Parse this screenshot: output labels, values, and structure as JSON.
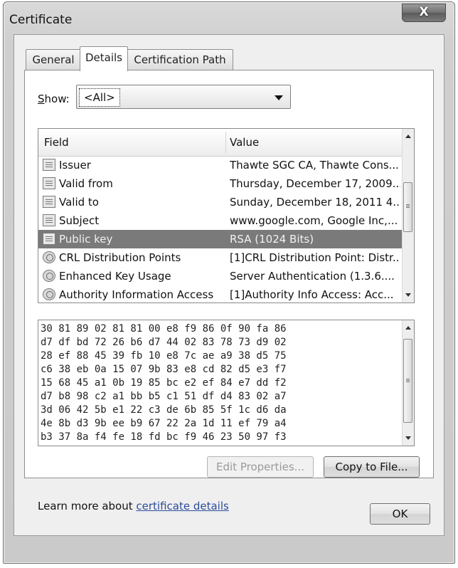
{
  "window": {
    "title": "Certificate",
    "close_label": "X"
  },
  "tabs": [
    {
      "label": "General"
    },
    {
      "label": "Details"
    },
    {
      "label": "Certification Path"
    }
  ],
  "show": {
    "label_prefix": "S",
    "label_rest": "how:",
    "selected": "<All>"
  },
  "fields_table": {
    "columns": [
      "Field",
      "Value"
    ],
    "rows": [
      {
        "field": "Issuer",
        "value": "Thawte SGC CA, Thawte Cons...",
        "icon": "document-icon"
      },
      {
        "field": "Valid from",
        "value": "Thursday, December 17, 2009...",
        "icon": "document-icon"
      },
      {
        "field": "Valid to",
        "value": "Sunday, December 18, 2011 4...",
        "icon": "document-icon"
      },
      {
        "field": "Subject",
        "value": "www.google.com, Google Inc,...",
        "icon": "document-icon"
      },
      {
        "field": "Public key",
        "value": "RSA (1024 Bits)",
        "icon": "document-icon",
        "selected": true
      },
      {
        "field": "CRL Distribution Points",
        "value": "[1]CRL Distribution Point: Distr...",
        "icon": "extension-icon"
      },
      {
        "field": "Enhanced Key Usage",
        "value": "Server Authentication (1.3.6....",
        "icon": "extension-icon"
      },
      {
        "field": "Authority Information Access",
        "value": "[1]Authority Info Access: Acc...",
        "icon": "extension-icon"
      }
    ]
  },
  "hex_value": "30 81 89 02 81 81 00 e8 f9 86 0f 90 fa 86\nd7 df bd 72 26 b6 d7 44 02 83 78 73 d9 02\n28 ef 88 45 39 fb 10 e8 7c ae a9 38 d5 75\nc6 38 eb 0a 15 07 9b 83 e8 cd 82 d5 e3 f7\n15 68 45 a1 0b 19 85 bc e2 ef 84 e7 dd f2\nd7 b8 98 c2 a1 bb b5 c1 51 df d4 83 02 a7\n3d 06 42 5b e1 22 c3 de 6b 85 5f 1c d6 da\n4e 8b d3 9b ee b9 67 22 2a 1d 11 ef 79 a4\nb3 37 8a f4 fe 18 fd bc f9 46 23 50 97 f3",
  "buttons": {
    "edit_properties": "Edit Properties...",
    "copy_to_file": "Copy to File...",
    "ok": "OK"
  },
  "learn_more": {
    "prefix": "Learn more about ",
    "link": "certificate details"
  }
}
